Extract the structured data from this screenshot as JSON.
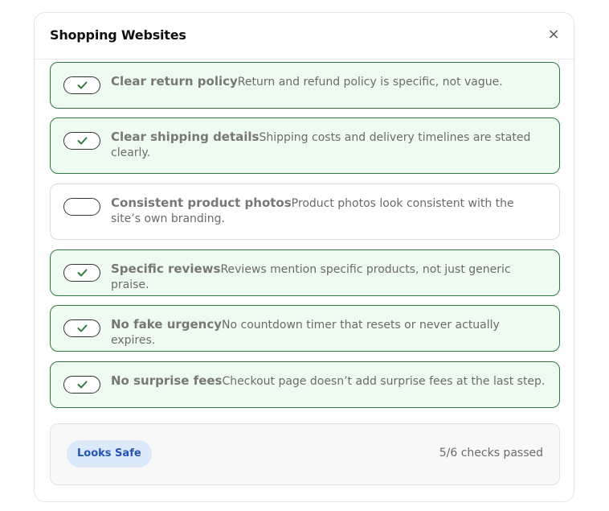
{
  "dialog": {
    "title": "Shopping Websites",
    "close_label": "×"
  },
  "checks": [
    {
      "title": "Clear return policy",
      "description": "Return and refund policy is specific, not vague.",
      "checked": true
    },
    {
      "title": "Clear shipping details",
      "description": "Shipping costs and delivery timelines are stated clearly.",
      "checked": true
    },
    {
      "title": "Consistent product photos",
      "description": "Product photos look consistent with the site’s own branding.",
      "checked": false
    },
    {
      "title": "Specific reviews",
      "description": "Reviews mention specific products, not just generic praise.",
      "checked": true
    },
    {
      "title": "No fake urgency",
      "description": "No countdown timer that resets or never actually expires.",
      "checked": true
    },
    {
      "title": "No surprise fees",
      "description": "Checkout page doesn’t add surprise fees at the last step.",
      "checked": true
    }
  ],
  "footer": {
    "badge": "Looks Safe",
    "summary": "5/6 checks passed"
  },
  "colors": {
    "passed_border": "#2f7a3f",
    "passed_bg": "#eefbf1",
    "badge_bg": "#dce9fb",
    "badge_text": "#2354b6"
  },
  "icons": {
    "close": "close-icon",
    "check": "checkmark-icon"
  }
}
